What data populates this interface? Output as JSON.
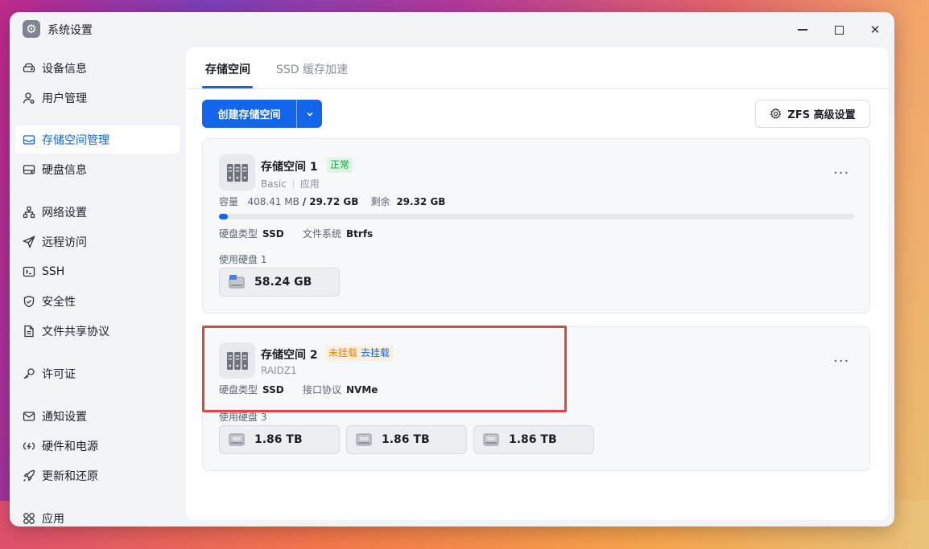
{
  "window": {
    "title": "系统设置"
  },
  "sidebar": {
    "items": [
      {
        "label": "设备信息",
        "icon": "hdd-icon"
      },
      {
        "label": "用户管理",
        "icon": "user-icon"
      },
      {
        "label": "存储空间管理",
        "icon": "storage-icon",
        "active": true
      },
      {
        "label": "硬盘信息",
        "icon": "disk-icon"
      },
      {
        "label": "网络设置",
        "icon": "network-icon"
      },
      {
        "label": "远程访问",
        "icon": "send-icon"
      },
      {
        "label": "SSH",
        "icon": "terminal-icon"
      },
      {
        "label": "安全性",
        "icon": "shield-icon"
      },
      {
        "label": "文件共享协议",
        "icon": "file-icon"
      },
      {
        "label": "许可证",
        "icon": "key-icon"
      },
      {
        "label": "通知设置",
        "icon": "mail-icon"
      },
      {
        "label": "硬件和电源",
        "icon": "power-icon"
      },
      {
        "label": "更新和还原",
        "icon": "rocket-icon"
      },
      {
        "label": "应用",
        "icon": "apps-icon"
      }
    ]
  },
  "tabs": [
    {
      "label": "存储空间",
      "active": true
    },
    {
      "label": "SSD 缓存加速"
    }
  ],
  "toolbar": {
    "create_label": "创建存储空间",
    "zfs_label": "ZFS 高级设置"
  },
  "pools": [
    {
      "name": "存储空间 1",
      "status": "正常",
      "type": "Basic",
      "usage": "应用",
      "capacity_label": "容量",
      "used": "408.41 MB",
      "total": "29.72 GB",
      "free_label": "剩余",
      "free": "29.32 GB",
      "used_fraction": 0.0134,
      "disk_type_label": "硬盘类型",
      "disk_type": "SSD",
      "fs_label": "文件系统",
      "fs": "Btrfs",
      "disks_label": "使用硬盘 1",
      "disks": [
        "58.24 GB"
      ]
    },
    {
      "name": "存储空间 2",
      "status": "未挂载",
      "status_action": "去挂载",
      "type": "RAIDZ1",
      "disk_type_label": "硬盘类型",
      "disk_type": "SSD",
      "iface_label": "接口协议",
      "iface": "NVMe",
      "disks_label": "使用硬盘 3",
      "disks": [
        "1.86 TB",
        "1.86 TB",
        "1.86 TB"
      ]
    }
  ],
  "colors": {
    "accent": "#1366ec",
    "ok": "#1e9b3f",
    "warn": "#e0860c",
    "highlight": "#e4453f"
  }
}
